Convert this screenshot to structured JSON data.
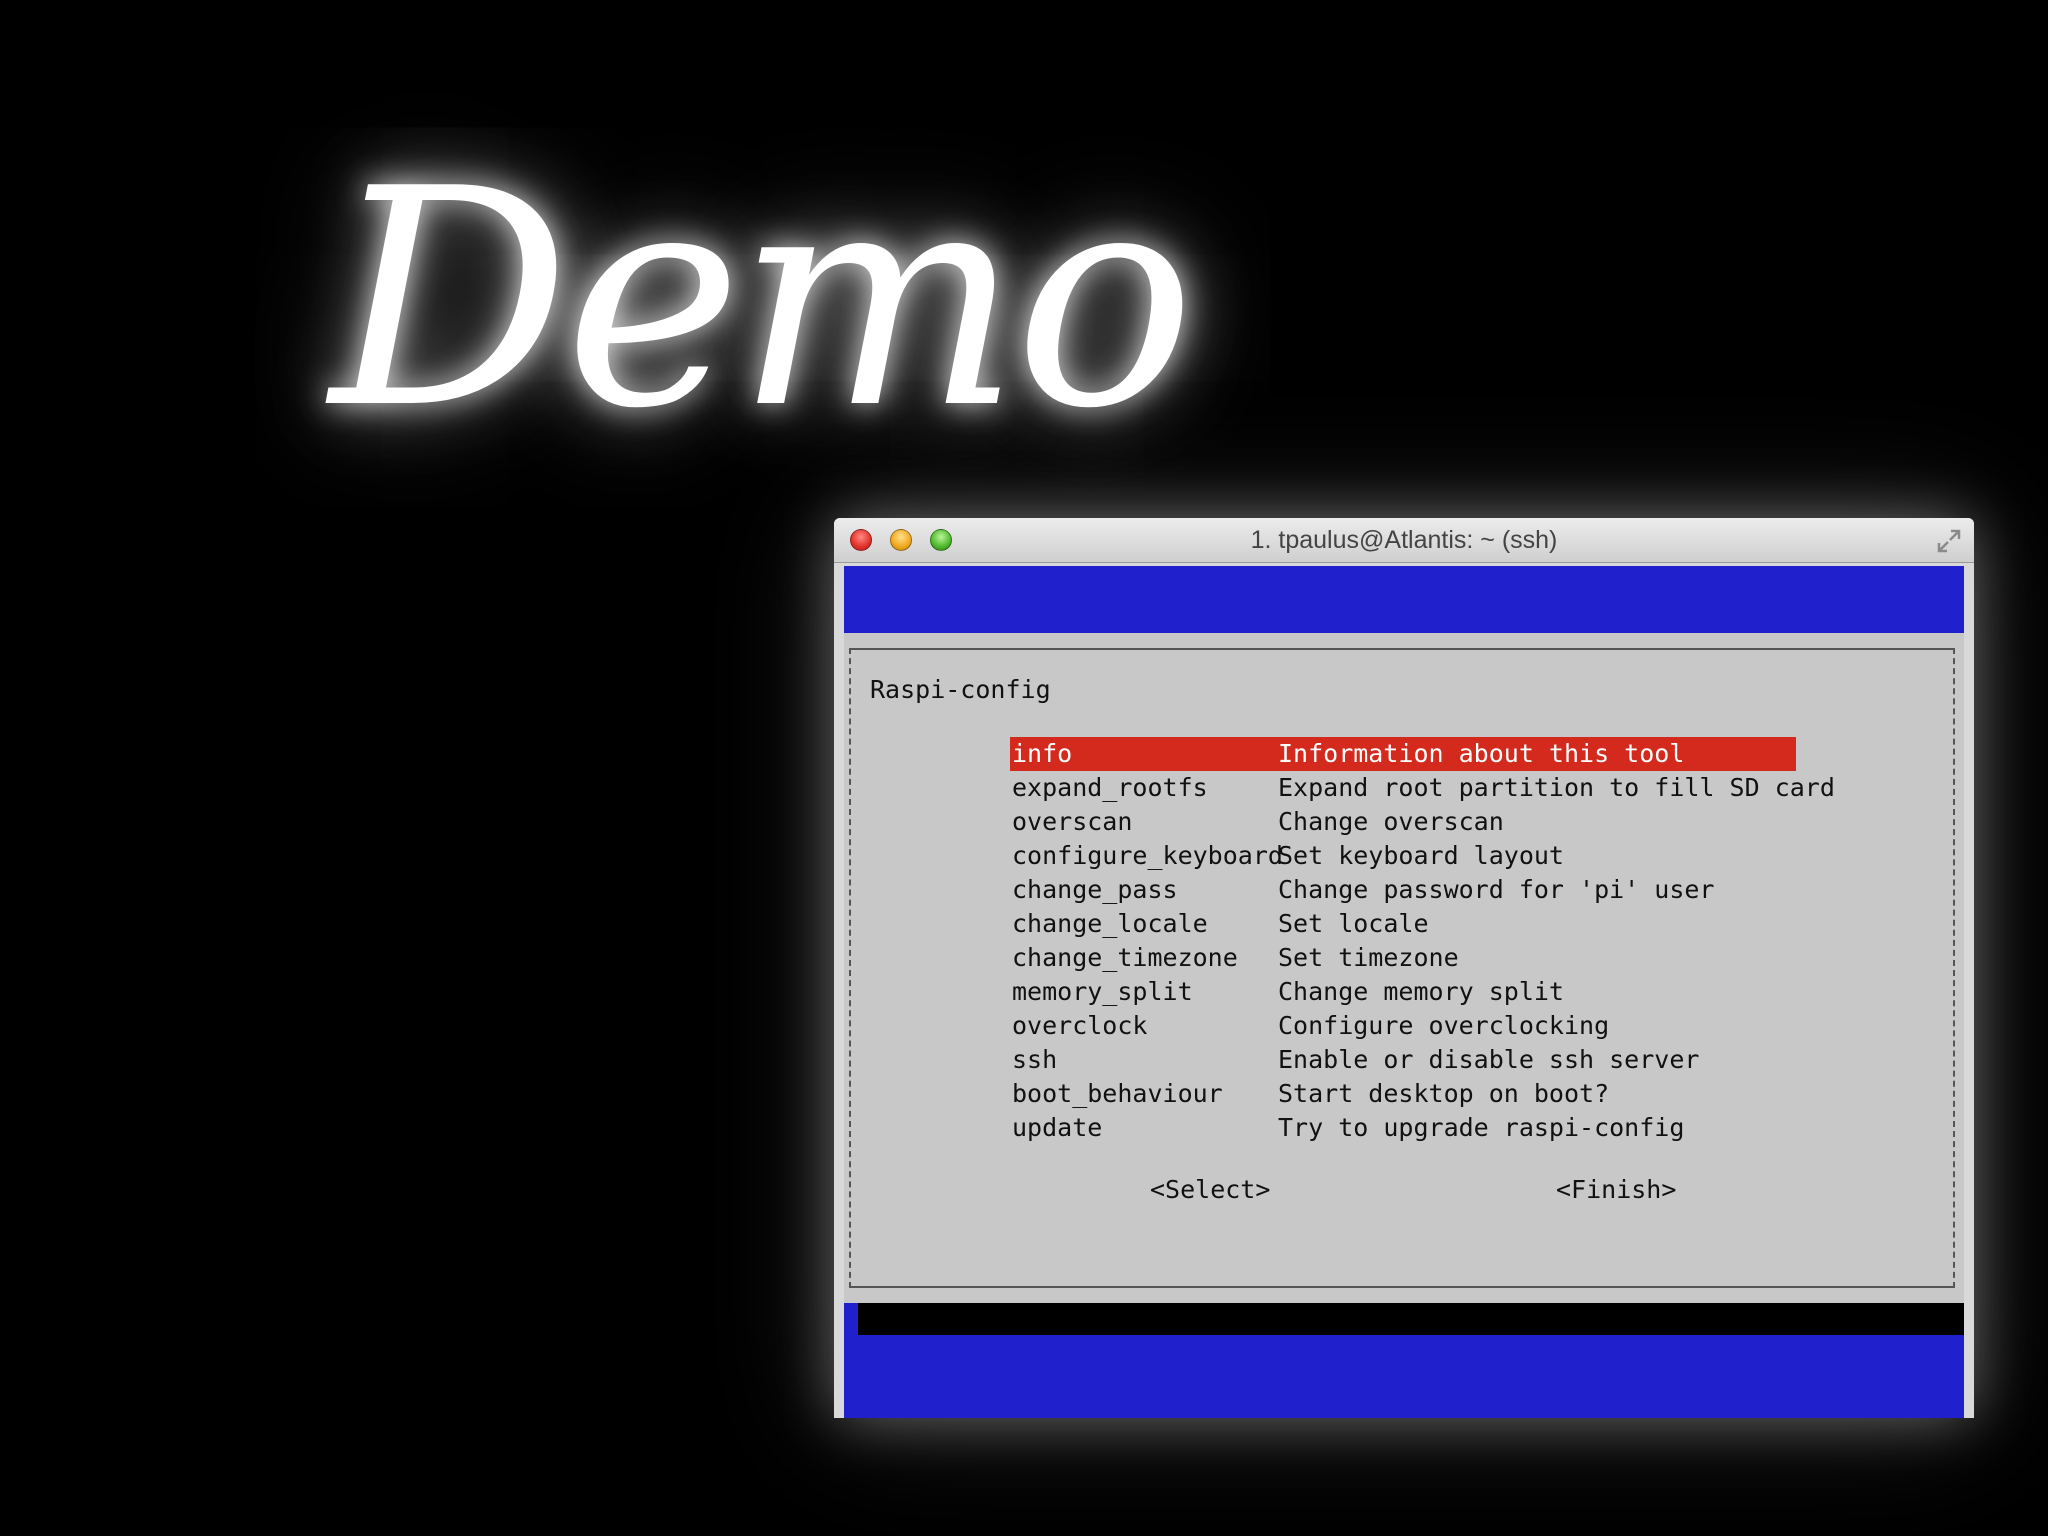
{
  "slide": {
    "title": "Demo"
  },
  "window": {
    "title": "1. tpaulus@Atlantis: ~ (ssh)"
  },
  "dialog": {
    "title": "Raspi-config",
    "selected_index": 0,
    "items": [
      {
        "key": "info",
        "desc": "Information about this tool"
      },
      {
        "key": "expand_rootfs",
        "desc": "Expand root partition to fill SD card"
      },
      {
        "key": "overscan",
        "desc": "Change overscan"
      },
      {
        "key": "configure_keyboard",
        "desc": "Set keyboard layout"
      },
      {
        "key": "change_pass",
        "desc": "Change password for 'pi' user"
      },
      {
        "key": "change_locale",
        "desc": "Set locale"
      },
      {
        "key": "change_timezone",
        "desc": "Set timezone"
      },
      {
        "key": "memory_split",
        "desc": "Change memory split"
      },
      {
        "key": "overclock",
        "desc": "Configure overclocking"
      },
      {
        "key": "ssh",
        "desc": "Enable or disable ssh server"
      },
      {
        "key": "boot_behaviour",
        "desc": "Start desktop on boot?"
      },
      {
        "key": "update",
        "desc": "Try to upgrade raspi-config"
      }
    ],
    "buttons": {
      "select": "<Select>",
      "finish": "<Finish>"
    }
  },
  "colors": {
    "terminal_background": "#2020cc",
    "dialog_background": "#c8c8c8",
    "selection": "#d42a1e",
    "slide_background": "#000000"
  },
  "icons": {
    "close": "close-button-icon",
    "minimize": "minimize-button-icon",
    "zoom": "zoom-button-icon",
    "fullscreen": "fullscreen-arrows-icon"
  }
}
